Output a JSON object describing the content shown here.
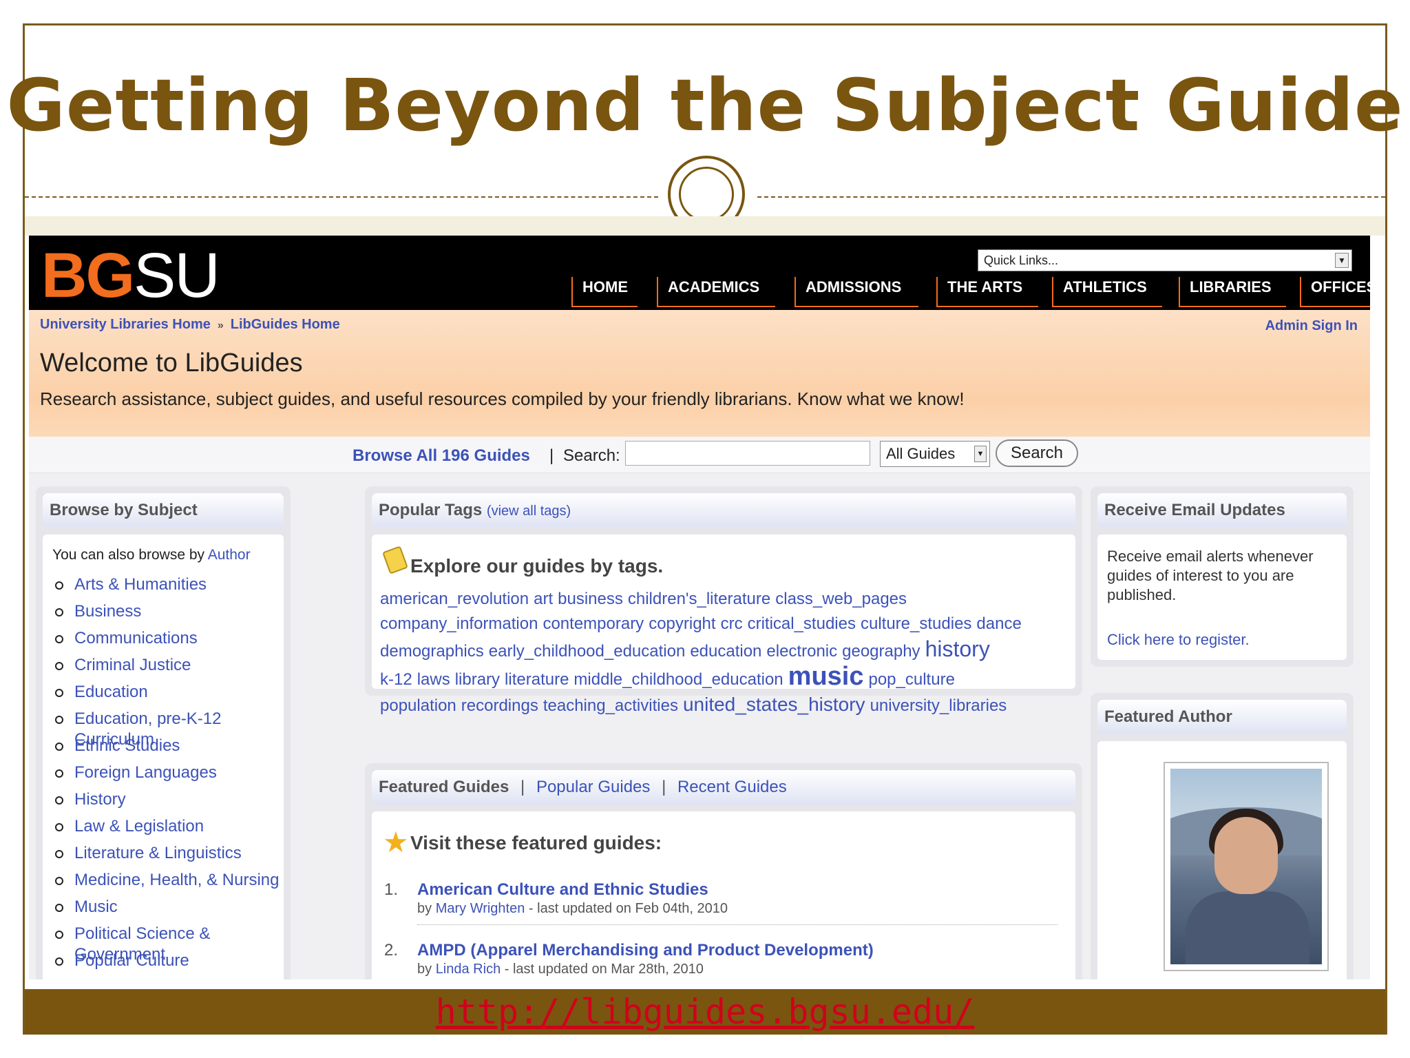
{
  "slide": {
    "title": "Getting Beyond the Subject Guide",
    "footer_url": "http://libguides.bgsu.edu/"
  },
  "site": {
    "logo_bg": "BG",
    "logo_su": "SU",
    "quick_links": "Quick Links...",
    "nav": [
      "HOME",
      "ACADEMICS",
      "ADMISSIONS",
      "THE ARTS",
      "ATHLETICS",
      "LIBRARIES",
      "OFFICES"
    ],
    "breadcrumb": [
      "University Libraries Home",
      "LibGuides Home"
    ],
    "breadcrumb_sep": "»",
    "admin_sign_in": "Admin Sign In",
    "welcome": "Welcome to LibGuides",
    "tagline": "Research assistance, subject guides, and useful resources compiled by your friendly librarians. Know what we know!"
  },
  "search": {
    "browse_all": "Browse All 196 Guides",
    "pipe": "|",
    "label": "Search:",
    "value": "",
    "scope": "All Guides",
    "button": "Search"
  },
  "browse_subject": {
    "title": "Browse by Subject",
    "intro": "You can also browse by ",
    "intro_link": "Author",
    "subjects": [
      "Arts & Humanities",
      "Business",
      "Communications",
      "Criminal Justice",
      "Education",
      "Education, pre-K-12 Curriculum",
      "Ethnic Studies",
      "Foreign Languages",
      "History",
      "Law & Legislation",
      "Literature & Linguistics",
      "Medicine, Health, & Nursing",
      "Music",
      "Political Science & Government",
      "Popular Culture"
    ]
  },
  "popular_tags": {
    "title": "Popular Tags",
    "view_all": "(view all tags)",
    "explore": "Explore our guides by tags.",
    "line1": [
      "american_revolution",
      "art",
      "business",
      "children's_literature",
      "class_web_pages"
    ],
    "line2": [
      "company_information",
      "contemporary",
      "copyright",
      "crc",
      "critical_studies",
      "culture_studies",
      "dance"
    ],
    "line3": [
      "demographics",
      "early_childhood_education",
      "education",
      "electronic",
      "geography"
    ],
    "line3_big": "history",
    "line4a": [
      "k-12",
      "laws",
      "library",
      "literature",
      "middle_childhood_education"
    ],
    "line4_huge": "music",
    "line4b": [
      "pop_culture"
    ],
    "line5a": [
      "population",
      "recordings",
      "teaching_activities"
    ],
    "line5_mid": "united_states_history",
    "line5b": [
      "university_libraries"
    ]
  },
  "featured_guides": {
    "tab_featured": "Featured Guides",
    "tab_popular": "Popular Guides",
    "tab_recent": "Recent Guides",
    "sep": "|",
    "visit": "Visit these featured guides:",
    "guides": [
      {
        "num": "1.",
        "title": "American Culture and Ethnic Studies",
        "by": "by ",
        "author": "Mary Wrighten",
        "updated": " - last updated on Feb 04th, 2010"
      },
      {
        "num": "2.",
        "title": "AMPD (Apparel Merchandising and Product Development)",
        "by": "by ",
        "author": "Linda Rich",
        "updated": " - last updated on Mar 28th, 2010"
      }
    ]
  },
  "email_updates": {
    "title": "Receive Email Updates",
    "text": "Receive email alerts whenever guides of interest to you are published.",
    "register": "Click here to register."
  },
  "featured_author": {
    "title": "Featured Author"
  },
  "colors": {
    "brown": "#7a5510",
    "orange": "#f26d1d",
    "link": "#3c52b8",
    "footer_link": "#d0021b"
  }
}
